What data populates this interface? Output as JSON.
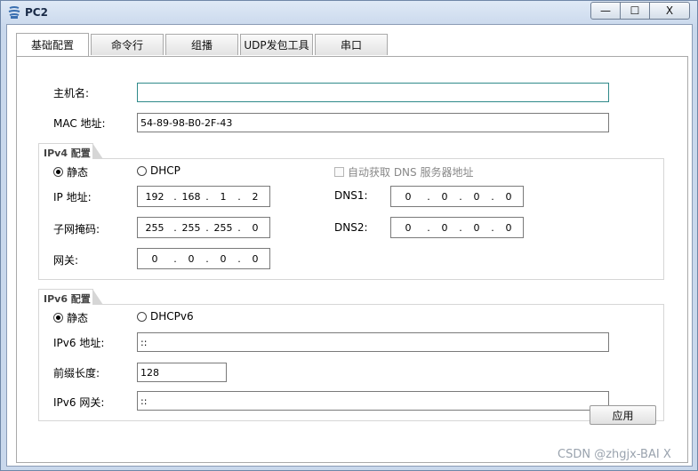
{
  "window": {
    "title": "PC2",
    "min_glyph": "—",
    "max_glyph": "☐",
    "close_glyph": "X"
  },
  "tabs": [
    "基础配置",
    "命令行",
    "组播",
    "UDP发包工具",
    "串口"
  ],
  "basic": {
    "hostname_label": "主机名:",
    "hostname_value": "",
    "mac_label": "MAC 地址:",
    "mac_value": "54-89-98-B0-2F-43"
  },
  "ipv4": {
    "section_title": "IPv4 配置",
    "static_label": "静态",
    "dhcp_label": "DHCP",
    "auto_dns_label": "自动获取 DNS 服务器地址",
    "ip_label": "IP 地址:",
    "ip_value": [
      "192",
      "168",
      "1",
      "2"
    ],
    "mask_label": "子网掩码:",
    "mask_value": [
      "255",
      "255",
      "255",
      "0"
    ],
    "gateway_label": "网关:",
    "gateway_value": [
      "0",
      "0",
      "0",
      "0"
    ],
    "dns1_label": "DNS1:",
    "dns1_value": [
      "0",
      "0",
      "0",
      "0"
    ],
    "dns2_label": "DNS2:",
    "dns2_value": [
      "0",
      "0",
      "0",
      "0"
    ]
  },
  "ipv6": {
    "section_title": "IPv6 配置",
    "static_label": "静态",
    "dhcp_label": "DHCPv6",
    "ip_label": "IPv6 地址:",
    "ip_value": "::",
    "prefix_label": "前缀长度:",
    "prefix_value": "128",
    "gateway_label": "IPv6 网关:",
    "gateway_value": "::"
  },
  "apply_label": "应用",
  "watermark": "CSDN @zhgjx-BAI X"
}
